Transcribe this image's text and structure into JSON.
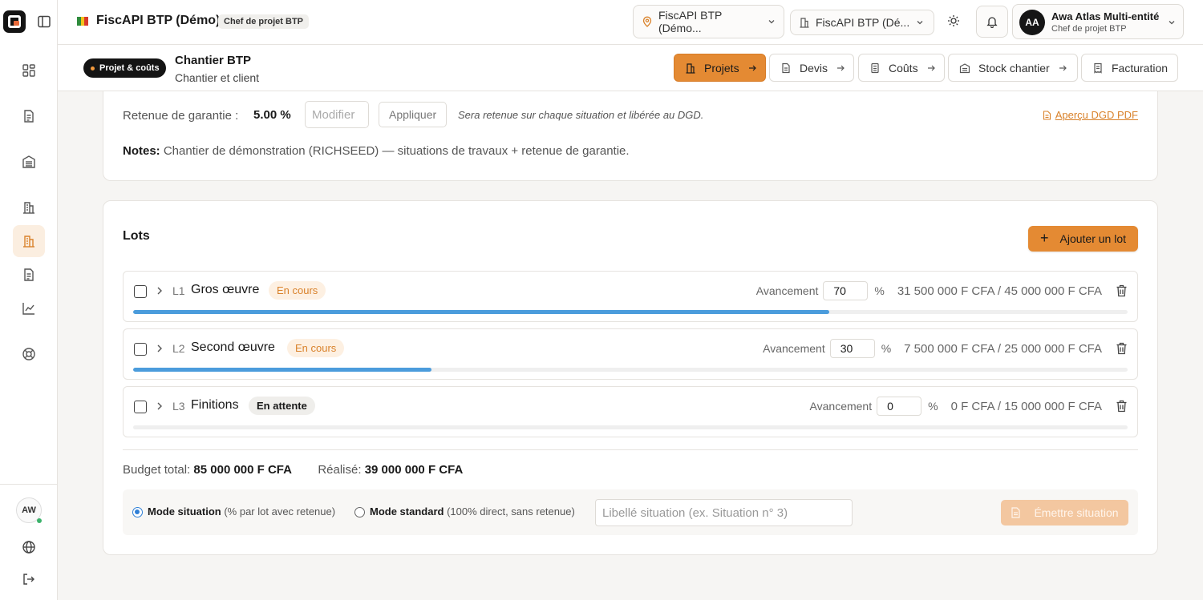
{
  "app": {
    "title": "FiscAPI BTP (Démo)",
    "role_chip": "Chef de projet BTP",
    "flag_colors": [
      "#2e8b3c",
      "#f2c21b",
      "#d93a2b"
    ],
    "accent": "#e48a33"
  },
  "header": {
    "location_selector": "FiscAPI BTP (Démo...",
    "company_selector": "FiscAPI BTP (Dé...",
    "user": {
      "initials": "AA",
      "name": "Awa Atlas Multi-entité",
      "role": "Chef de projet BTP"
    }
  },
  "sidebar": {
    "items": [
      {
        "icon": "dashboard-grid-icon"
      },
      {
        "icon": "document-icon"
      },
      {
        "icon": "warehouse-icon"
      },
      {
        "icon": "building-icon"
      },
      {
        "icon": "building-icon",
        "active": true
      },
      {
        "icon": "document-icon"
      },
      {
        "icon": "chart-line-icon"
      },
      {
        "icon": "support-icon"
      }
    ],
    "user_initials": "AW"
  },
  "subheader": {
    "section_chip": "Projet & coûts",
    "title": "Chantier BTP",
    "subtitle": "Chantier et client",
    "tabs": [
      {
        "label": "Projets",
        "active": true
      },
      {
        "label": "Devis"
      },
      {
        "label": "Coûts"
      },
      {
        "label": "Stock chantier"
      },
      {
        "label": "Facturation"
      }
    ]
  },
  "retenue": {
    "label": "Retenue de garantie :",
    "value": "5.00 %",
    "input_placeholder": "Modifier",
    "apply_label": "Appliquer",
    "hint": "Sera retenue sur chaque situation et libérée au DGD.",
    "dgd_link": "Aperçu DGD PDF"
  },
  "notes": {
    "label": "Notes:",
    "text": "Chantier de démonstration (RICHSEED) — situations de travaux + retenue de garantie."
  },
  "lots": {
    "title": "Lots",
    "add_label": "Ajouter un lot",
    "progress_label": "Avancement",
    "percent_sign": "%",
    "items": [
      {
        "code": "L1",
        "name": "Gros œuvre",
        "status": "En cours",
        "progress": "70",
        "amount": "31 500 000 F CFA / 45 000 000 F CFA"
      },
      {
        "code": "L2",
        "name": "Second œuvre",
        "status": "En cours",
        "progress": "30",
        "amount": "7 500 000 F CFA / 25 000 000 F CFA"
      },
      {
        "code": "L3",
        "name": "Finitions",
        "status": "En attente",
        "progress": "0",
        "amount": "0 F CFA / 15 000 000 F CFA"
      }
    ]
  },
  "totals": {
    "budget_label": "Budget total:",
    "budget_value": "85 000 000 F CFA",
    "realise_label": "Réalisé:",
    "realise_value": "39 000 000 F CFA"
  },
  "situation": {
    "mode_situation_label": "Mode situation",
    "mode_situation_hint": "(% par lot avec retenue)",
    "mode_standard_label": "Mode standard",
    "mode_standard_hint": "(100% direct, sans retenue)",
    "libelle_placeholder": "Libellé situation (ex. Situation n° 3)",
    "emit_label": "Émettre situation"
  }
}
